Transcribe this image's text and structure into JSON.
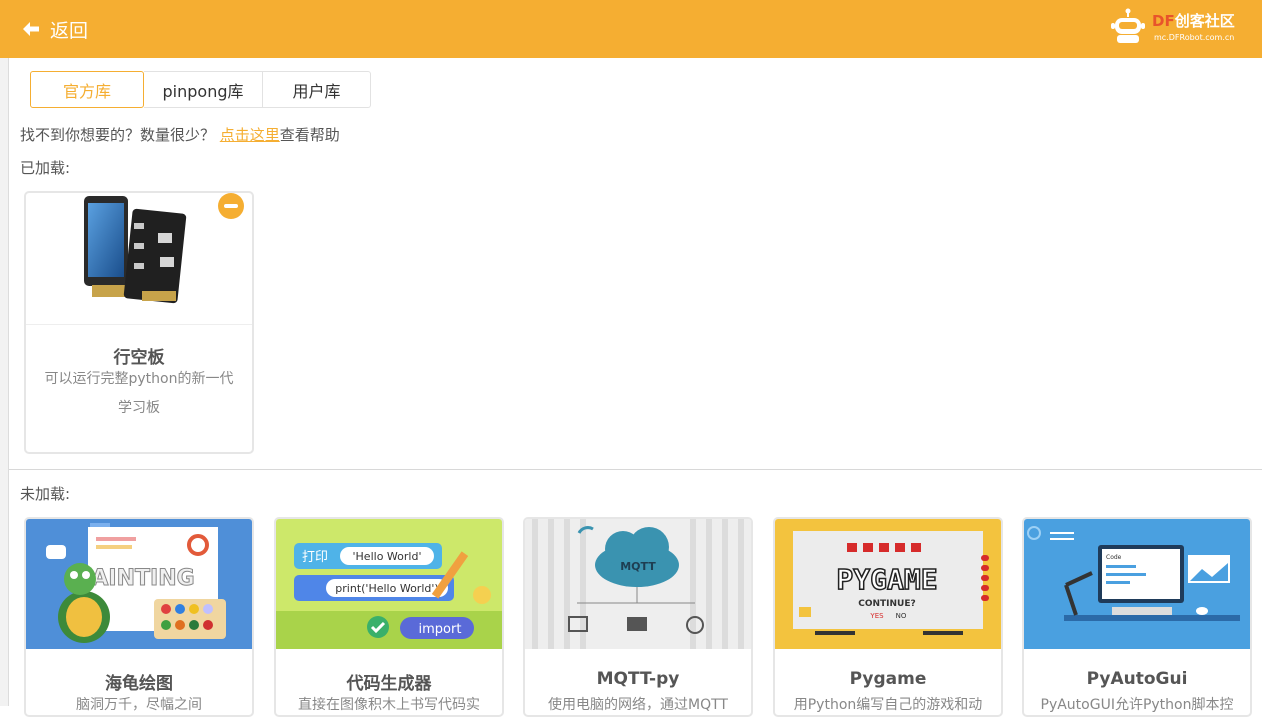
{
  "header": {
    "back_label": "返回",
    "logo_brand_df": "DF",
    "logo_brand_rest": "创客社区",
    "logo_url": "mc.DFRobot.com.cn",
    "bg_color": "#f5ae32"
  },
  "tabs": [
    {
      "label": "官方库",
      "active": true
    },
    {
      "label": "pinpong库",
      "active": false
    },
    {
      "label": "用户库",
      "active": false
    }
  ],
  "help": {
    "prefix": "找不到你想要的？数量很少？ ",
    "link": "点击这里",
    "suffix": "查看帮助"
  },
  "loaded": {
    "label": "已加载:",
    "cards": [
      {
        "title": "行空板",
        "desc": "可以运行完整python的新一代学习板"
      }
    ]
  },
  "unloaded": {
    "label": "未加载:",
    "cards": [
      {
        "title": "海龟绘图",
        "desc": "脑洞万千，尽幅之间",
        "thumb_text": "PAINTING"
      },
      {
        "title": "代码生成器",
        "desc": "直接在图像积木上书写代码实",
        "thumb_text1": "打印",
        "thumb_text2": "'Hello World'",
        "thumb_text3": "print('Hello World')",
        "thumb_text4": "import"
      },
      {
        "title": "MQTT-py",
        "desc": "使用电脑的网络，通过MQTT",
        "thumb_text": "MQTT"
      },
      {
        "title": "Pygame",
        "desc": "用Python编写自己的游戏和动",
        "thumb_text": "PYGAME",
        "thumb_text2": "CONTINUE?",
        "thumb_yes": "YES",
        "thumb_no": "NO"
      },
      {
        "title": "PyAutoGui",
        "desc": "PyAutoGUI允许Python脚本控",
        "thumb_text": "Code"
      }
    ]
  }
}
